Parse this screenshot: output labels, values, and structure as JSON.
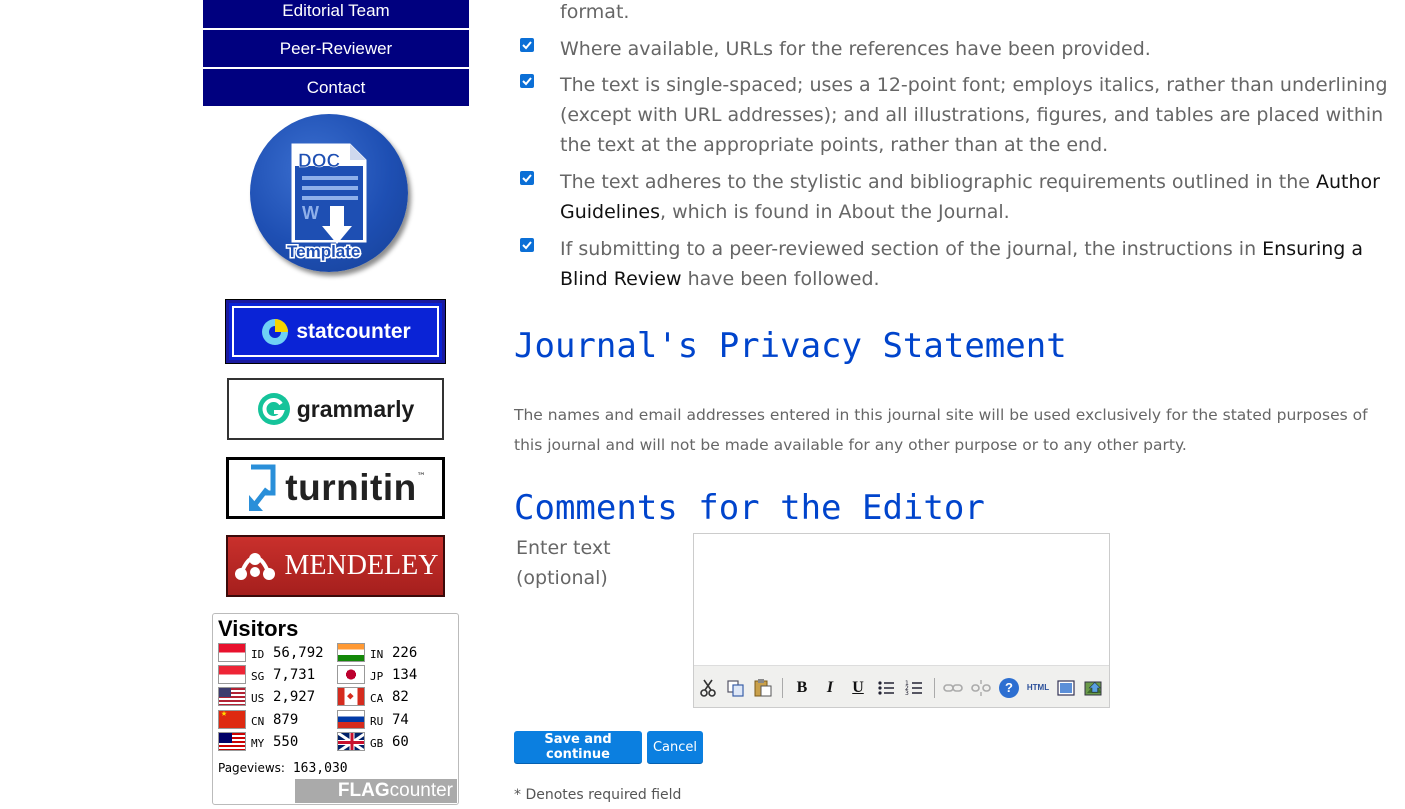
{
  "sidebar": {
    "nav_items": [
      {
        "label": "Editorial Team"
      },
      {
        "label": "Peer-Reviewer"
      },
      {
        "label": "Contact"
      }
    ],
    "doc_template": {
      "top_label": "DOC",
      "bottom_label": "Template"
    },
    "badges": {
      "statcounter": "statcounter",
      "grammarly": "grammarly",
      "turnitin": "turnitin",
      "turnitin_mark": "™",
      "mendeley": "MENDELEY"
    },
    "flag_counter": {
      "title": "Visitors",
      "countries": [
        {
          "code": "ID",
          "count": "56,792"
        },
        {
          "code": "SG",
          "count": "7,731"
        },
        {
          "code": "US",
          "count": "2,927"
        },
        {
          "code": "CN",
          "count": "879"
        },
        {
          "code": "MY",
          "count": "550"
        },
        {
          "code": "IN",
          "count": "226"
        },
        {
          "code": "JP",
          "count": "134"
        },
        {
          "code": "CA",
          "count": "82"
        },
        {
          "code": "RU",
          "count": "74"
        },
        {
          "code": "GB",
          "count": "60"
        }
      ],
      "pageviews_label": "Pageviews:",
      "pageviews_value": "163,030",
      "brand_bold": "FLAG",
      "brand_light": "counter"
    }
  },
  "checklist": {
    "top_fragment": "format.",
    "items": [
      {
        "checked": true,
        "text": "Where available, URLs for the references have been provided."
      },
      {
        "checked": true,
        "text": "The text is single-spaced; uses a 12-point font; employs italics, rather than underlining (except with URL addresses); and all illustrations, figures, and tables are placed within the text at the appropriate points, rather than at the end."
      },
      {
        "checked": true,
        "pre": "The text adheres to the stylistic and bibliographic requirements outlined in the ",
        "link": "Author Guidelines",
        "post": ", which is found in About the Journal."
      },
      {
        "checked": true,
        "pre": "If submitting to a peer-reviewed section of the journal, the instructions in ",
        "link": "Ensuring a Blind Review",
        "post": " have been followed."
      }
    ]
  },
  "privacy": {
    "heading": "Journal's Privacy Statement",
    "text": "The names and email addresses entered in this journal site will be used exclusively for the stated purposes of this journal and will not be made available for any other purpose or to any other party."
  },
  "comments": {
    "heading": "Comments for the Editor",
    "label": "Enter text (optional)",
    "value": ""
  },
  "toolbar": {
    "icons": [
      "cut-icon",
      "copy-icon",
      "paste-icon",
      "bold-icon",
      "italic-icon",
      "underline-icon",
      "bullet-list-icon",
      "numbered-list-icon",
      "link-icon",
      "unlink-icon",
      "help-icon",
      "html-icon",
      "fullscreen-icon",
      "upload-image-icon"
    ],
    "bold": "B",
    "italic": "I",
    "underline": "U",
    "html": "HTML",
    "help": "?"
  },
  "actions": {
    "save_label": "Save and continue",
    "cancel_label": "Cancel"
  },
  "required_note": "* Denotes required field",
  "colors": {
    "nav_bg": "#00007f",
    "heading": "#0044cc",
    "button": "#0b7fe0",
    "checkbox": "#0b6fd6"
  }
}
